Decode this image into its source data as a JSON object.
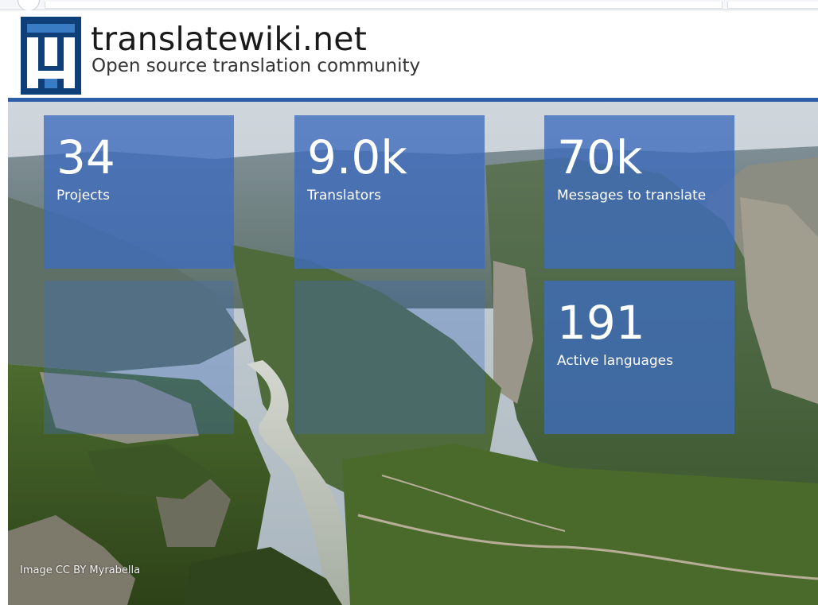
{
  "header": {
    "title": "translatewiki.net",
    "tagline": "Open source translation community",
    "logo_icon": "translatewiki-logo",
    "accent_color": "#2f5ea8",
    "logo_colors": [
      "#0e3f78",
      "#3a7cc4"
    ]
  },
  "stats": [
    {
      "value": "34",
      "label": "Projects"
    },
    {
      "value": "9.0k",
      "label": "Translators"
    },
    {
      "value": "70k",
      "label": "Messages to translate"
    },
    {
      "value": "191",
      "label": "Active languages"
    }
  ],
  "hero": {
    "credit": "Image CC BY Myrabella",
    "tile_color": "#3e6cbe"
  }
}
